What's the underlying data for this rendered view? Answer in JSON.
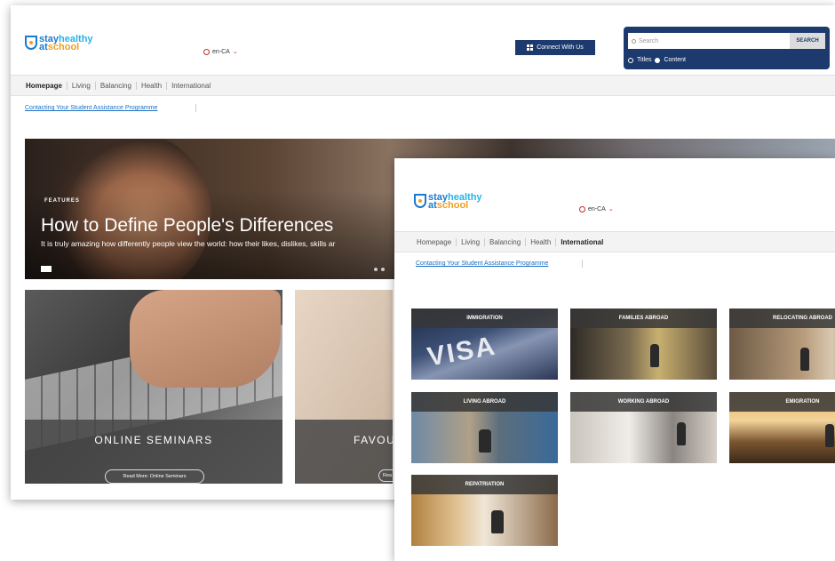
{
  "back_window": {
    "logo": {
      "stay": "stay",
      "healthy": "healthy",
      "at": "at",
      "school": "school"
    },
    "language": "en-CA",
    "connect_button": "Connect With Us",
    "search": {
      "placeholder": "Search",
      "button": "SEARCH",
      "options": [
        "Titles",
        "Content"
      ]
    },
    "nav": [
      "Homepage",
      "Living",
      "Balancing",
      "Health",
      "International"
    ],
    "active_nav": "Homepage",
    "sublink": "Contacting Your Student Assistance Programme",
    "hero": {
      "badge": "FEATURES",
      "title": "How to Define People's Differences",
      "description": "It is truly amazing how differently people view the world: how their likes, dislikes, skills ar"
    },
    "cards": [
      {
        "caption": "ONLINE SEMINARS",
        "button": "Read More: Online Seminars"
      },
      {
        "caption": "FAVOU",
        "button": "Rea"
      }
    ]
  },
  "front_window": {
    "logo": {
      "stay": "stay",
      "healthy": "healthy",
      "at": "at",
      "school": "school"
    },
    "language": "en-CA",
    "nav": [
      "Homepage",
      "Living",
      "Balancing",
      "Health",
      "International"
    ],
    "active_nav": "International",
    "sublink": "Contacting Your Student Assistance Programme",
    "tiles": [
      "IMMIGRATION",
      "FAMILIES ABROAD",
      "RELOCATING ABROAD",
      "LIVING ABROAD",
      "WORKING ABROAD",
      "EMIGRATION",
      "REPATRIATION"
    ],
    "visa_text": "VISA"
  },
  "colors": {
    "brand_blue": "#1a7bd1",
    "brand_orange": "#f29f1d",
    "navy": "#1d3a6e",
    "link": "#1a6fc4"
  }
}
